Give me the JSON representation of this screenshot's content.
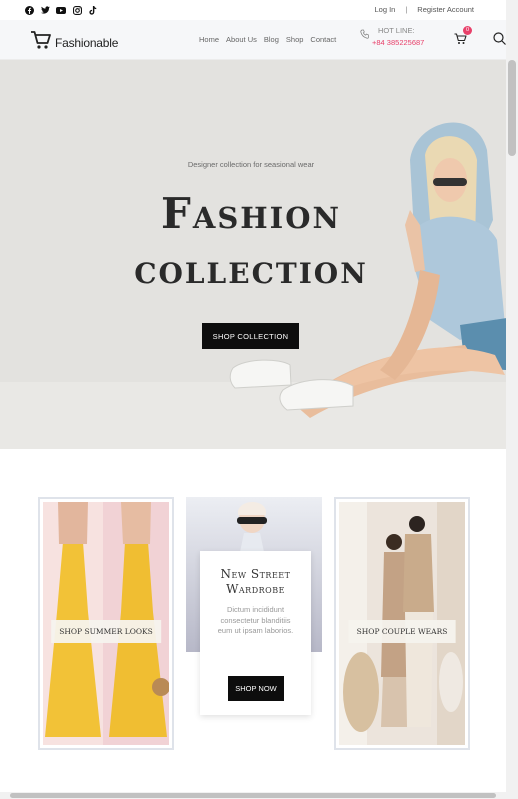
{
  "topbar": {
    "social_icons": [
      "facebook-icon",
      "twitter-icon",
      "youtube-icon",
      "instagram-icon",
      "tiktok-icon"
    ],
    "login": "Log In",
    "separator": "|",
    "register": "Register Account"
  },
  "header": {
    "logo": "Fashionable",
    "nav": [
      "Home",
      "About Us",
      "Blog",
      "Shop",
      "Contact"
    ],
    "hotline_label": "HOT LINE:",
    "hotline_number": "+84 385225687",
    "cart_count": "0"
  },
  "hero": {
    "subtitle": "Designer collection for seasional wear",
    "title_line1": "Fashion",
    "title_line2": "collection",
    "button": "SHOP COLLECTION"
  },
  "cards": {
    "left_label": "SHOP SUMMER LOOKS",
    "right_label": "SHOP COUPLE WEARS",
    "middle_title": "New Street Wardrobe",
    "middle_desc": "Dictum incididunt consectetur blanditiis eum ut ipsam laborios.",
    "middle_button": "SHOP NOW"
  },
  "colors": {
    "accent": "#e8406a",
    "button_bg": "#0d0d0d",
    "hero_bg": "#e3e2df"
  }
}
